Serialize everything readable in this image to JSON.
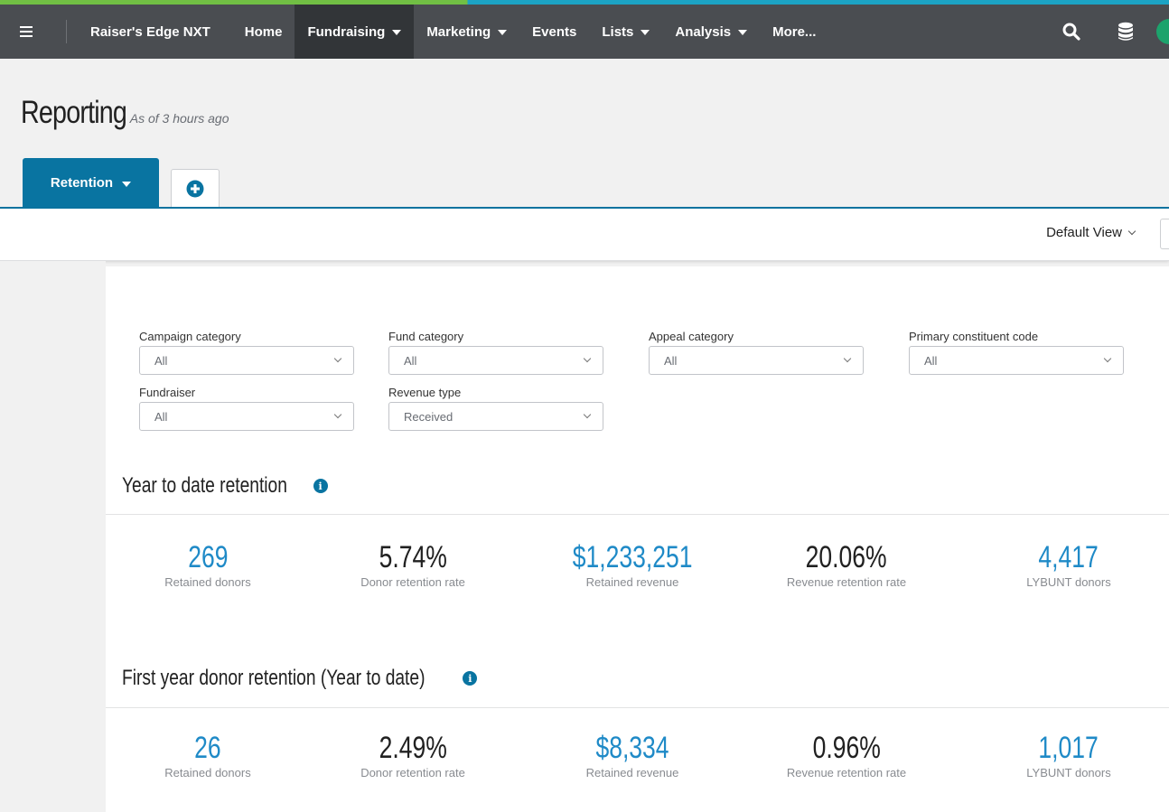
{
  "nav": {
    "brand": "Raiser's Edge NXT",
    "items": [
      {
        "label": "Home",
        "dropdown": false,
        "active": false
      },
      {
        "label": "Fundraising",
        "dropdown": true,
        "active": true
      },
      {
        "label": "Marketing",
        "dropdown": true,
        "active": false
      },
      {
        "label": "Events",
        "dropdown": false,
        "active": false
      },
      {
        "label": "Lists",
        "dropdown": true,
        "active": false
      },
      {
        "label": "Analysis",
        "dropdown": true,
        "active": false
      },
      {
        "label": "More...",
        "dropdown": false,
        "active": false
      }
    ],
    "icons": [
      "search-icon",
      "database-icon"
    ]
  },
  "page": {
    "title": "Reporting",
    "subtitle": "As of 3 hours ago"
  },
  "tabs": {
    "active": "Retention",
    "add_icon": "plus-circle-icon"
  },
  "viewbar": {
    "view": "Default View"
  },
  "filters": {
    "campaign_category": {
      "label": "Campaign category",
      "value": "All"
    },
    "fund_category": {
      "label": "Fund category",
      "value": "All"
    },
    "appeal_category": {
      "label": "Appeal category",
      "value": "All"
    },
    "primary_constituent_code": {
      "label": "Primary constituent code",
      "value": "All"
    },
    "fundraiser": {
      "label": "Fundraiser",
      "value": "All"
    },
    "revenue_type": {
      "label": "Revenue type",
      "value": "Received"
    }
  },
  "ytd": {
    "title": "Year to date retention",
    "kpis": [
      {
        "value": "269",
        "label": "Retained donors",
        "link": true
      },
      {
        "value": "5.74%",
        "label": "Donor retention rate",
        "link": false
      },
      {
        "value": "$1,233,251",
        "label": "Retained revenue",
        "link": true
      },
      {
        "value": "20.06%",
        "label": "Revenue retention rate",
        "link": false
      },
      {
        "value": "4,417",
        "label": "LYBUNT donors",
        "link": true
      }
    ]
  },
  "first_year": {
    "title": "First year donor retention (Year to date)",
    "kpis": [
      {
        "value": "26",
        "label": "Retained donors",
        "link": true
      },
      {
        "value": "2.49%",
        "label": "Donor retention rate",
        "link": false
      },
      {
        "value": "$8,334",
        "label": "Retained revenue",
        "link": true
      },
      {
        "value": "0.96%",
        "label": "Revenue retention rate",
        "link": false
      },
      {
        "value": "1,017",
        "label": "LYBUNT donors",
        "link": true
      }
    ]
  },
  "colors": {
    "nav_bg": "#4a4d51",
    "nav_active": "#323538",
    "accent_blue": "#0974a1",
    "link_blue": "#1f8ac7"
  }
}
